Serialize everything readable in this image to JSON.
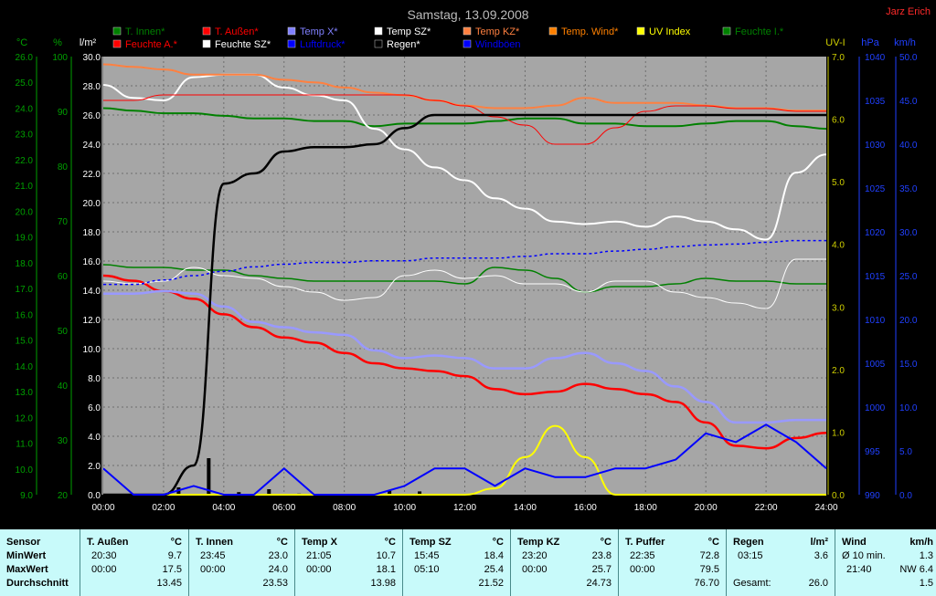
{
  "title": "Samstag, 13.09.2008",
  "author": "Jarz Erich",
  "colors": {
    "background": "#000000",
    "plot": "#a6a6a6",
    "grid": "#6e6e6e"
  },
  "chart_data": {
    "type": "line",
    "x_ticks": [
      "00:00",
      "02:00",
      "04:00",
      "06:00",
      "08:00",
      "10:00",
      "12:00",
      "14:00",
      "16:00",
      "18:00",
      "20:00",
      "22:00",
      "24:00"
    ],
    "axes": {
      "temp_c": {
        "unit": "°C",
        "color": "#008000",
        "ticks": [
          "26.0",
          "25.0",
          "24.0",
          "23.0",
          "22.0",
          "21.0",
          "20.0",
          "19.0",
          "18.0",
          "17.0",
          "16.0",
          "15.0",
          "14.0",
          "13.0",
          "12.0",
          "11.0",
          "10.0",
          "9.0"
        ]
      },
      "humidity": {
        "unit": "%",
        "color": "#008000",
        "ticks": [
          "100",
          "90",
          "80",
          "70",
          "60",
          "50",
          "40",
          "30",
          "20"
        ]
      },
      "rain": {
        "unit": "l/m²",
        "color": "#000000",
        "ticks": [
          "30.0",
          "28.0",
          "26.0",
          "24.0",
          "22.0",
          "20.0",
          "18.0",
          "16.0",
          "14.0",
          "12.0",
          "10.0",
          "8.0",
          "6.0",
          "4.0",
          "2.0",
          "0.0"
        ],
        "ylim": [
          0,
          30
        ]
      },
      "uv": {
        "unit": "UV-I",
        "color": "#d0d000",
        "ticks": [
          "7.0",
          "6.0",
          "5.0",
          "4.0",
          "3.0",
          "2.0",
          "1.0",
          "0.0"
        ],
        "ylim": [
          0,
          7
        ]
      },
      "pressure": {
        "unit": "hPa",
        "color": "#0000ff",
        "ticks": [
          "1040",
          "1035",
          "1030",
          "1025",
          "1020",
          "1015",
          "1010",
          "1005",
          "1000",
          "995",
          "990"
        ],
        "ylim": [
          990,
          1040
        ]
      },
      "wind": {
        "unit": "km/h",
        "color": "#0000ff",
        "ticks": [
          "50.0",
          "45.0",
          "40.0",
          "35.0",
          "30.0",
          "25.0",
          "20.0",
          "15.0",
          "10.0",
          "5.0",
          "0.0"
        ],
        "ylim": [
          0,
          50
        ]
      }
    },
    "legend": [
      {
        "label": "T. Innen*",
        "color": "#008000"
      },
      {
        "label": "T. Außen*",
        "color": "#ff0000"
      },
      {
        "label": "Temp X*",
        "color": "#8080ff"
      },
      {
        "label": "Temp SZ*",
        "color": "#ffffff"
      },
      {
        "label": "Temp KZ*",
        "color": "#ff8040"
      },
      {
        "label": "Temp. Wind*",
        "color": "#ff8000"
      },
      {
        "label": "UV Index",
        "color": "#ffff00"
      },
      {
        "label": "Feuchte I.*",
        "color": "#008000"
      },
      {
        "label": "Feuchte A.*",
        "color": "#ff0000"
      },
      {
        "label": "Feuchte SZ*",
        "color": "#ffffff"
      },
      {
        "label": "Luftdruck*",
        "color": "#0000ff"
      },
      {
        "label": "Regen*",
        "color": "#000000"
      },
      {
        "label": "Windböen",
        "color": "#0000ff"
      }
    ],
    "x_hours": [
      0,
      1,
      2,
      3,
      4,
      5,
      6,
      7,
      8,
      9,
      10,
      11,
      12,
      13,
      14,
      15,
      16,
      17,
      18,
      19,
      20,
      21,
      22,
      23,
      24
    ],
    "series": [
      {
        "name": "T. Innen*",
        "axis": "temp_c",
        "color": "#008000",
        "width": 2,
        "values": [
          24.0,
          23.9,
          23.8,
          23.8,
          23.7,
          23.6,
          23.6,
          23.5,
          23.5,
          23.3,
          23.4,
          23.4,
          23.4,
          23.5,
          23.6,
          23.6,
          23.4,
          23.4,
          23.3,
          23.3,
          23.4,
          23.5,
          23.5,
          23.3,
          23.2
        ]
      },
      {
        "name": "T. Außen*",
        "axis": "temp_c",
        "color": "#ff0000",
        "width": 2.5,
        "values": [
          17.5,
          17.3,
          16.9,
          16.6,
          16.0,
          15.5,
          15.1,
          14.9,
          14.5,
          14.1,
          13.9,
          13.8,
          13.6,
          13.1,
          12.9,
          13.0,
          13.3,
          13.1,
          12.9,
          12.6,
          11.8,
          10.9,
          10.8,
          11.2,
          11.4
        ]
      },
      {
        "name": "Temp X*",
        "axis": "temp_c",
        "color": "#9999ff",
        "width": 2.5,
        "values": [
          16.8,
          16.8,
          16.9,
          16.8,
          16.3,
          15.7,
          15.5,
          15.3,
          15.2,
          14.6,
          14.3,
          14.4,
          14.3,
          13.9,
          13.9,
          14.3,
          14.5,
          14.1,
          13.8,
          13.2,
          12.6,
          11.8,
          11.8,
          11.9,
          11.9
        ]
      },
      {
        "name": "Temp SZ*",
        "axis": "temp_c",
        "color": "#ffffff",
        "width": 2,
        "values": [
          24.9,
          24.4,
          24.3,
          25.2,
          25.3,
          25.3,
          24.8,
          24.5,
          24.3,
          23.2,
          22.4,
          21.7,
          21.2,
          20.5,
          20.1,
          19.6,
          19.5,
          19.6,
          19.4,
          19.8,
          19.6,
          19.3,
          18.9,
          21.5,
          22.2
        ]
      },
      {
        "name": "Temp KZ*",
        "axis": "temp_c",
        "color": "#ff8040",
        "width": 2,
        "values": [
          25.7,
          25.6,
          25.5,
          25.3,
          25.3,
          25.3,
          25.1,
          25.0,
          24.8,
          24.6,
          24.5,
          24.3,
          24.1,
          24.0,
          24.0,
          24.1,
          24.4,
          24.2,
          24.2,
          24.2,
          24.1,
          24.0,
          24.0,
          23.9,
          23.9
        ]
      },
      {
        "name": "Feuchte I.*",
        "axis": "humidity",
        "color": "#008000",
        "width": 1.5,
        "values": [
          62,
          61.5,
          61.5,
          61,
          61,
          60,
          59.5,
          59,
          59,
          59,
          59,
          59,
          58.5,
          61.5,
          61,
          59.5,
          57,
          58,
          58,
          58.5,
          59.5,
          59,
          59,
          58.5,
          58.5
        ]
      },
      {
        "name": "Feuchte A.*",
        "axis": "humidity",
        "color": "#ff0000",
        "width": 1,
        "values": [
          92,
          92,
          93,
          93,
          93,
          93,
          93,
          93,
          93,
          93,
          93,
          92,
          91,
          89,
          87.5,
          84,
          84,
          87,
          90,
          91,
          91,
          90.5,
          90.5,
          90,
          90
        ]
      },
      {
        "name": "Feuchte SZ*",
        "axis": "humidity",
        "color": "#ffffff",
        "width": 1,
        "values": [
          59,
          58.5,
          59,
          61.5,
          60,
          59.5,
          58,
          57,
          55.5,
          56,
          60,
          61,
          59.5,
          60,
          58.5,
          58.5,
          57,
          59,
          59,
          57,
          56,
          55,
          54,
          63,
          63
        ]
      },
      {
        "name": "Luftdruck*",
        "axis": "pressure",
        "color": "#0000ff",
        "width": 1.5,
        "dash": "3,3",
        "values": [
          1014,
          1014,
          1014.5,
          1015,
          1015.5,
          1016,
          1016.3,
          1016.5,
          1016.5,
          1016.7,
          1016.7,
          1017,
          1017,
          1017,
          1017.2,
          1017.5,
          1017.5,
          1017.8,
          1018,
          1018.3,
          1018.5,
          1018.6,
          1018.8,
          1019,
          1019
        ]
      },
      {
        "name": "UV Index",
        "axis": "uv",
        "color": "#ffff00",
        "width": 2,
        "values": [
          0,
          0,
          0,
          0,
          0,
          0,
          0,
          0,
          0,
          0,
          0,
          0,
          0,
          0.1,
          0.6,
          1.1,
          0.6,
          0,
          0,
          0,
          0,
          0,
          0,
          0,
          0
        ]
      },
      {
        "name": "Regen*",
        "axis": "rain",
        "color": "#000000",
        "width": 2.5,
        "values": [
          0,
          0,
          0,
          2.0,
          21.3,
          22.0,
          23.5,
          23.8,
          23.8,
          24.0,
          25.1,
          26.0,
          26.0,
          26.0,
          26.0,
          26.0,
          26.0,
          26.0,
          26.0,
          26.0,
          26.0,
          26.0,
          26.0,
          26.0,
          26.0
        ]
      },
      {
        "name": "Windböen",
        "axis": "wind",
        "color": "#0000ff",
        "width": 2,
        "values": [
          3,
          0,
          0,
          1,
          0,
          0,
          3,
          0,
          0,
          0,
          1,
          3,
          3,
          1,
          3,
          2,
          2,
          3,
          3,
          4,
          7,
          6,
          8,
          6,
          3
        ]
      }
    ]
  },
  "stats": {
    "rows": [
      "Sensor",
      "MinWert",
      "MaxWert",
      "Durchschnitt"
    ],
    "columns": [
      {
        "name": "T. Außen",
        "unit": "°C",
        "min_time": "20:30",
        "min": "9.7",
        "max_time": "00:00",
        "max": "17.5",
        "avg": "13.45"
      },
      {
        "name": "T. Innen",
        "unit": "°C",
        "min_time": "23:45",
        "min": "23.0",
        "max_time": "00:00",
        "max": "24.0",
        "avg": "23.53"
      },
      {
        "name": "Temp X",
        "unit": "°C",
        "min_time": "21:05",
        "min": "10.7",
        "max_time": "00:00",
        "max": "18.1",
        "avg": "13.98"
      },
      {
        "name": "Temp SZ",
        "unit": "°C",
        "min_time": "15:45",
        "min": "18.4",
        "max_time": "05:10",
        "max": "25.4",
        "avg": "21.52"
      },
      {
        "name": "Temp KZ",
        "unit": "°C",
        "min_time": "23:20",
        "min": "23.8",
        "max_time": "00:00",
        "max": "25.7",
        "avg": "24.73"
      },
      {
        "name": "T. Puffer",
        "unit": "°C",
        "min_time": "22:35",
        "min": "72.8",
        "max_time": "00:00",
        "max": "79.5",
        "avg": "76.70"
      },
      {
        "name": "Regen",
        "unit": "l/m²",
        "min_time": "03:15",
        "min": "3.6",
        "max_time": "",
        "max": "",
        "avg_label": "Gesamt:",
        "avg": "26.0"
      },
      {
        "name": "Wind",
        "unit": "km/h",
        "min_time": "Ø 10 min.",
        "min": "1.3",
        "max_time": "21:40",
        "max": "NW 6.4",
        "avg": "1.5"
      }
    ]
  }
}
